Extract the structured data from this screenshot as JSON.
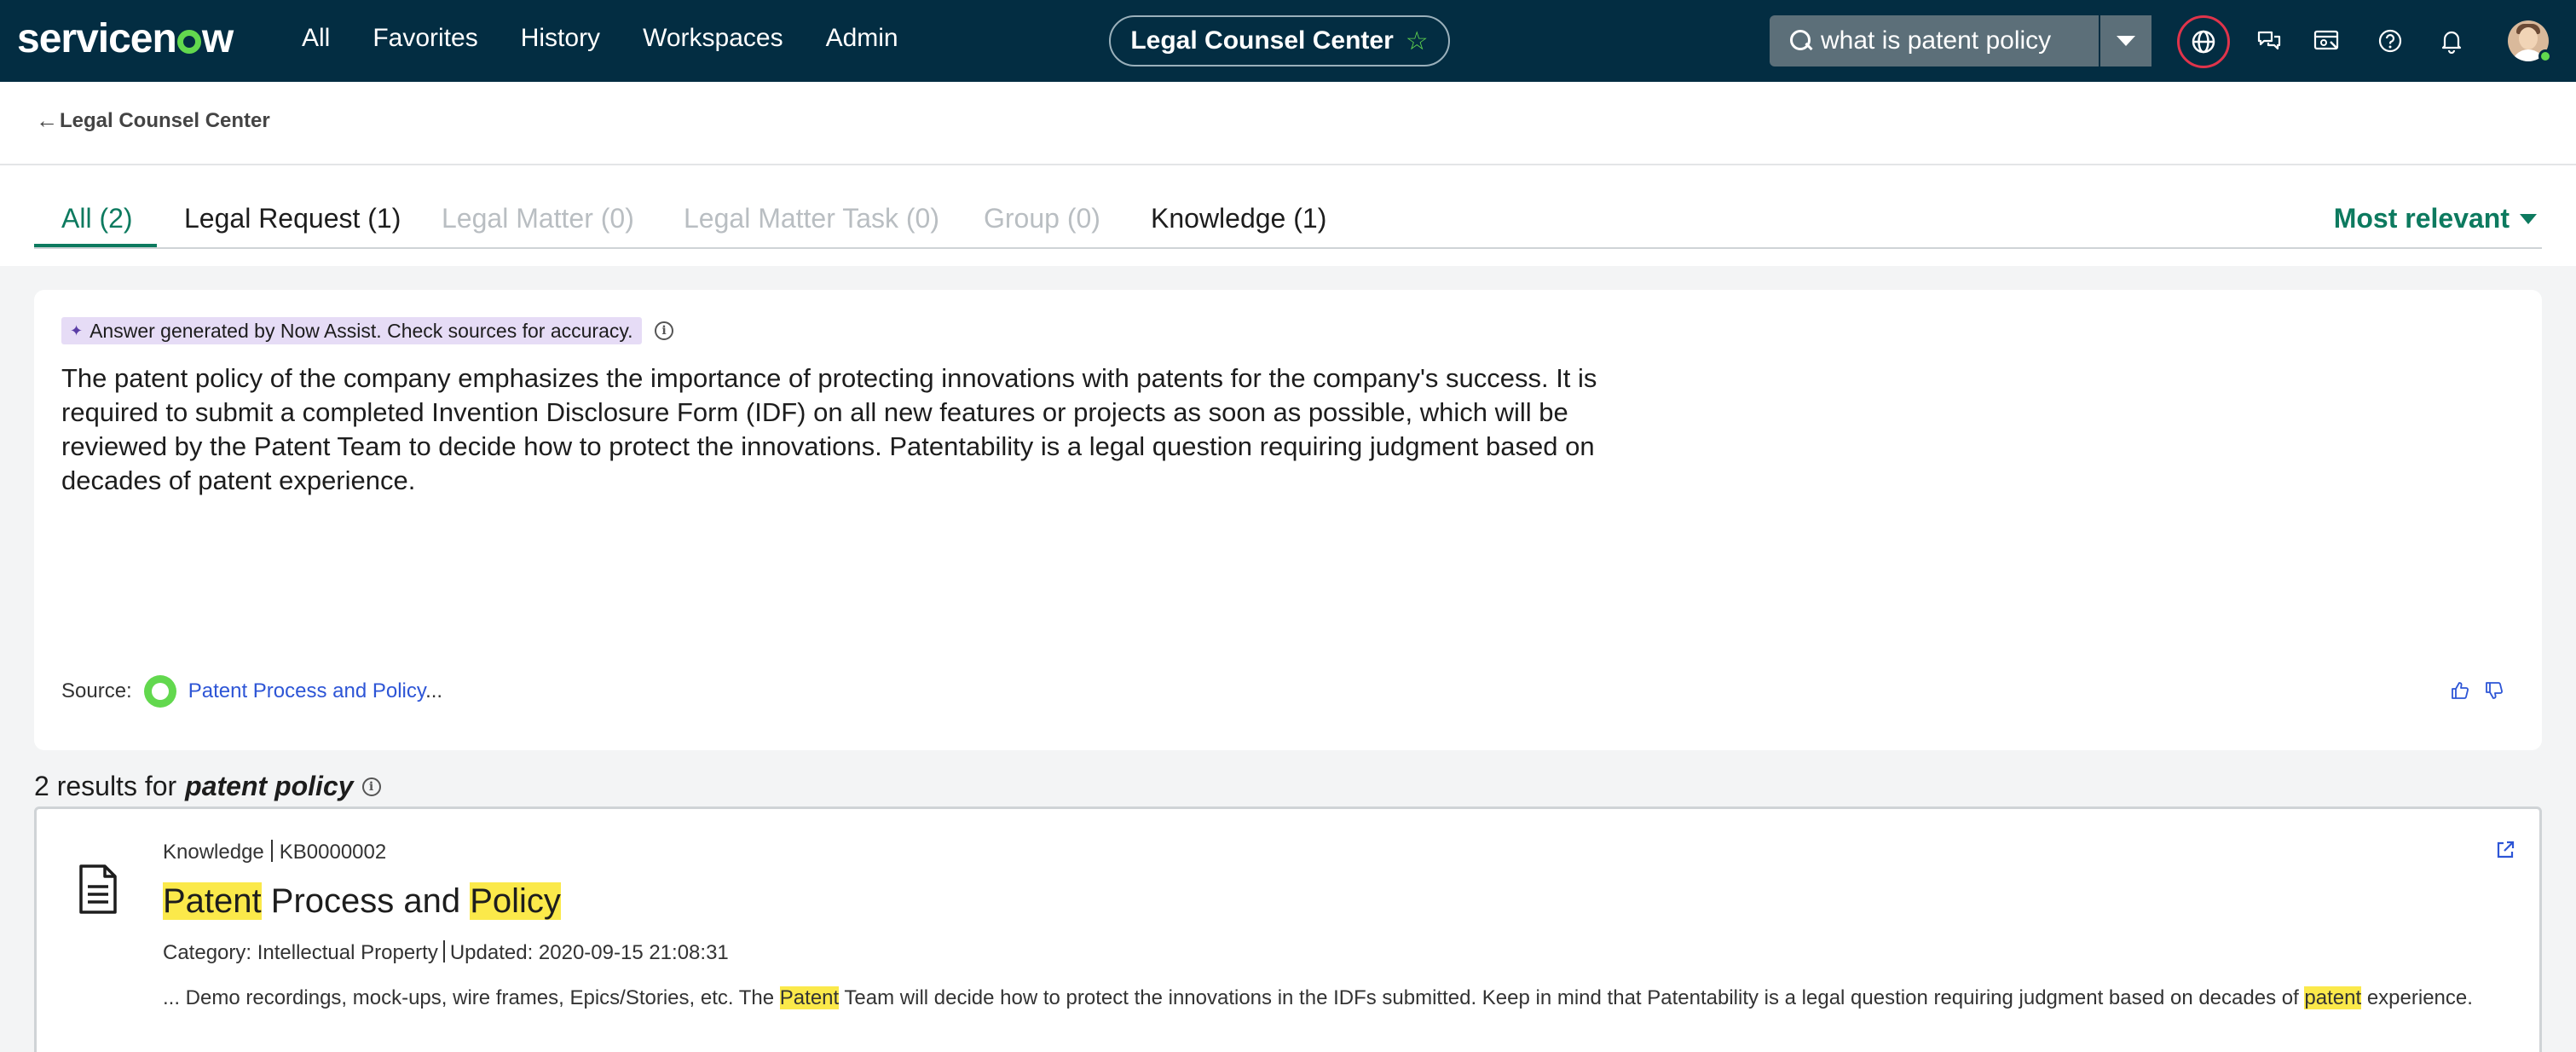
{
  "topbar": {
    "logo_parts": [
      "servicen",
      "w"
    ],
    "nav": [
      "All",
      "Favorites",
      "History",
      "Workspaces",
      "Admin"
    ],
    "workspace_title": "Legal Counsel Center",
    "search_value": "what is patent policy"
  },
  "breadcrumb": {
    "back_label": "Legal Counsel Center"
  },
  "tabs": {
    "items": [
      {
        "label": "All (2)",
        "state": "active"
      },
      {
        "label": "Legal Request (1)",
        "state": "normal"
      },
      {
        "label": "Legal Matter (0)",
        "state": "disabled"
      },
      {
        "label": "Legal Matter Task (0)",
        "state": "disabled"
      },
      {
        "label": "Group (0)",
        "state": "disabled"
      },
      {
        "label": "Knowledge (1)",
        "state": "normal"
      }
    ],
    "sort_label": "Most relevant"
  },
  "answer": {
    "badge": "Answer generated by Now Assist. Check sources for accuracy.",
    "text": "The patent policy of the company emphasizes the importance of protecting innovations with patents for the company's success. It is required to submit a completed Invention Disclosure Form (IDF) on all new features or projects as soon as possible, which will be reviewed by the Patent Team to decide how to protect the innovations. Patentability is a legal question requiring judgment based on decades of patent experience.",
    "source_label": "Source:",
    "source_link": "Patent Process and Policy",
    "source_ellipsis": "..."
  },
  "results": {
    "count_text": "2 results for",
    "query": "patent policy"
  },
  "result_card": {
    "type": "Knowledge",
    "number": "KB0000002",
    "title_parts": [
      "Patent",
      " Process and ",
      "Policy"
    ],
    "category": "Category: Intellectual Property",
    "updated": "Updated: 2020-09-15 21:08:31",
    "snippet_parts": [
      "... Demo recordings, mock-ups, wire frames, Epics/Stories, etc. The ",
      "Patent",
      " Team will decide how to protect the innovations in the IDFs submitted. Keep in mind that Patentability is a legal question requiring judgment based on decades of ",
      "patent",
      " experience."
    ]
  },
  "colors": {
    "topbar": "#032d42",
    "accent_green": "#0d7a5f",
    "logo_green": "#62d84e",
    "link_blue": "#2d55d6",
    "highlight": "#fbe94a",
    "ai_badge": "#e6dcf6"
  },
  "icons": [
    "star-icon",
    "search-icon",
    "chevron-down-icon",
    "globe-icon",
    "chat-icon",
    "screen-icon",
    "help-icon",
    "bell-icon",
    "back-arrow-icon",
    "sparkle-icon",
    "info-icon",
    "thumbs-up-icon",
    "thumbs-down-icon",
    "document-icon",
    "external-link-icon"
  ]
}
